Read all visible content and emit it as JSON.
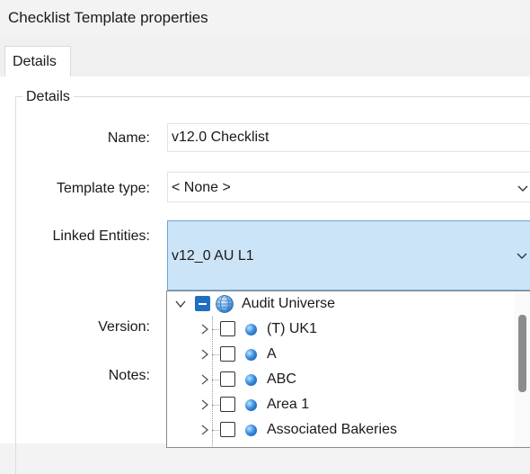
{
  "window": {
    "title": "Checklist Template properties"
  },
  "tabs": [
    {
      "label": "Details"
    }
  ],
  "group": {
    "legend": "Details"
  },
  "form": {
    "name_label": "Name:",
    "name_value": "v12.0 Checklist",
    "template_type_label": "Template type:",
    "template_type_value": "< None >",
    "linked_entities_label": "Linked Entities:",
    "linked_entities_value": "v12_0 AU L1",
    "version_label": "Version:",
    "notes_label": "Notes:"
  },
  "tree": {
    "root": {
      "label": "Audit Universe",
      "icon": "globe-icon",
      "state": "indeterminate",
      "expanded": true
    },
    "items": [
      {
        "label": "(T) UK1",
        "icon": "entity-dot-icon"
      },
      {
        "label": "A",
        "icon": "entity-dot-icon"
      },
      {
        "label": "ABC",
        "icon": "entity-dot-icon"
      },
      {
        "label": "Area 1",
        "icon": "entity-dot-icon"
      },
      {
        "label": "Associated Bakeries",
        "icon": "entity-dot-icon"
      }
    ]
  },
  "colors": {
    "selection": "#cce4f7",
    "selection_border": "#6aa8dc",
    "checkbox_indeterminate": "#1f6fc1"
  }
}
